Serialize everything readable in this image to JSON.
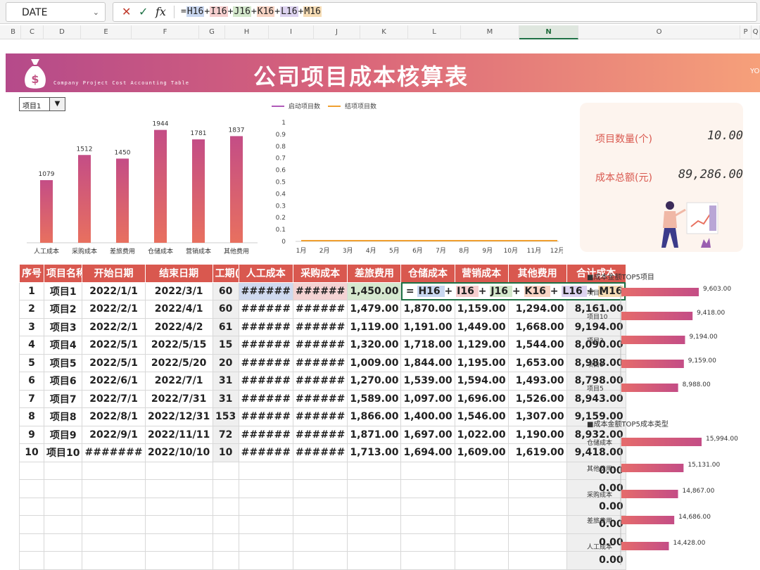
{
  "formula_bar": {
    "name_box": "DATE",
    "cancel_icon": "✕",
    "enter_icon": "✓",
    "fx_label": "fx",
    "formula_parts": [
      "=",
      "H16",
      "+",
      "I16",
      "+",
      "J16",
      "+",
      "K16",
      "+",
      "L16",
      "+",
      "M16"
    ]
  },
  "columns": [
    "B",
    "C",
    "D",
    "E",
    "F",
    "G",
    "H",
    "I",
    "J",
    "K",
    "L",
    "M",
    "N",
    "O",
    "P",
    "Q"
  ],
  "banner": {
    "title": "公司项目成本核算表",
    "subtitle": "Company Project Cost Accounting Table",
    "edge_text": "YO"
  },
  "dropdown": {
    "value": "项目1",
    "arrow": "▼"
  },
  "bar_chart": {
    "type": "bar",
    "categories": [
      "人工成本",
      "采购成本",
      "差旅费用",
      "仓储成本",
      "营销成本",
      "其他费用"
    ],
    "values": [
      1079,
      1512,
      1450,
      1944,
      1781,
      1837
    ],
    "ylim": [
      0,
      2000
    ],
    "colors": {
      "top": "#c44d86",
      "bottom": "#e8705f"
    }
  },
  "line_chart": {
    "type": "line",
    "legend": [
      "启动项目数",
      "结项项目数"
    ],
    "legend_colors": [
      "#b05ab8",
      "#f0a030"
    ],
    "x": [
      "1月",
      "2月",
      "3月",
      "4月",
      "5月",
      "6月",
      "7月",
      "8月",
      "9月",
      "10月",
      "11月",
      "12月"
    ],
    "yticks": [
      "1",
      "0.9",
      "0.8",
      "0.7",
      "0.6",
      "0.5",
      "0.4",
      "0.3",
      "0.2",
      "0.1",
      "0"
    ],
    "series": [
      {
        "name": "启动项目数",
        "values": [
          0,
          0,
          0,
          0,
          0,
          0,
          0,
          0,
          0,
          0,
          0,
          0
        ]
      },
      {
        "name": "结项项目数",
        "values": [
          0,
          0,
          0,
          0,
          0,
          0,
          0,
          0,
          0,
          0,
          0,
          0
        ]
      }
    ],
    "ylim": [
      0,
      1
    ]
  },
  "kpis": [
    {
      "label": "项目数量(个)",
      "value": "10.00"
    },
    {
      "label": "成本总额(元)",
      "value": "89,286.00"
    }
  ],
  "table": {
    "headers": [
      "序号",
      "项目名称",
      "开始日期",
      "结束日期",
      "工期(天)",
      "人工成本",
      "采购成本",
      "差旅费用",
      "仓储成本",
      "营销成本",
      "其他费用",
      "合计成本"
    ],
    "rows": [
      [
        "1",
        "项目1",
        "2022/1/1",
        "2022/3/1",
        "60",
        "######",
        "######",
        "1,450.00",
        "",
        "",
        "",
        ""
      ],
      [
        "2",
        "项目2",
        "2022/2/1",
        "2022/4/1",
        "60",
        "######",
        "######",
        "1,479.00",
        "1,870.00",
        "1,159.00",
        "1,294.00",
        "8,161.00"
      ],
      [
        "3",
        "项目3",
        "2022/2/1",
        "2022/4/2",
        "61",
        "######",
        "######",
        "1,119.00",
        "1,191.00",
        "1,449.00",
        "1,668.00",
        "9,194.00"
      ],
      [
        "4",
        "项目4",
        "2022/5/1",
        "2022/5/15",
        "15",
        "######",
        "######",
        "1,320.00",
        "1,718.00",
        "1,129.00",
        "1,544.00",
        "8,090.00"
      ],
      [
        "5",
        "项目5",
        "2022/5/1",
        "2022/5/20",
        "20",
        "######",
        "######",
        "1,009.00",
        "1,844.00",
        "1,195.00",
        "1,653.00",
        "8,988.00"
      ],
      [
        "6",
        "项目6",
        "2022/6/1",
        "2022/7/1",
        "31",
        "######",
        "######",
        "1,270.00",
        "1,539.00",
        "1,594.00",
        "1,493.00",
        "8,798.00"
      ],
      [
        "7",
        "项目7",
        "2022/7/1",
        "2022/7/31",
        "31",
        "######",
        "######",
        "1,589.00",
        "1,097.00",
        "1,696.00",
        "1,526.00",
        "8,943.00"
      ],
      [
        "8",
        "项目8",
        "2022/8/1",
        "2022/12/31",
        "153",
        "######",
        "######",
        "1,866.00",
        "1,400.00",
        "1,546.00",
        "1,307.00",
        "9,159.00"
      ],
      [
        "9",
        "项目9",
        "2022/9/1",
        "2022/11/11",
        "72",
        "######",
        "######",
        "1,871.00",
        "1,697.00",
        "1,022.00",
        "1,190.00",
        "8,932.00"
      ],
      [
        "10",
        "项目10",
        "#######",
        "2022/10/10",
        "10",
        "######",
        "######",
        "1,713.00",
        "1,694.00",
        "1,609.00",
        "1,619.00",
        "9,418.00"
      ]
    ],
    "empty_totals": [
      "0.00",
      "0.00",
      "0.00",
      "0.00",
      "0.00",
      "0.00"
    ],
    "inline_formula": "= H16 + I16 + J16 + K16 + L16 + M16"
  },
  "top5_projects": {
    "title": "■成本金额TOP5项目",
    "items": [
      {
        "name": "项目1",
        "value": 9603,
        "label": "9,603.00"
      },
      {
        "name": "项目10",
        "value": 9418,
        "label": "9,418.00"
      },
      {
        "name": "项目3",
        "value": 9194,
        "label": "9,194.00"
      },
      {
        "name": "项目8",
        "value": 9159,
        "label": "9,159.00"
      },
      {
        "name": "项目5",
        "value": 8988,
        "label": "8,988.00"
      }
    ]
  },
  "top5_types": {
    "title": "■成本金额TOP5成本类型",
    "items": [
      {
        "name": "仓储成本",
        "value": 15994,
        "label": "15,994.00"
      },
      {
        "name": "其他费用",
        "value": 15131,
        "label": "15,131.00"
      },
      {
        "name": "采购成本",
        "value": 14867,
        "label": "14,867.00"
      },
      {
        "name": "差旅费用",
        "value": 14686,
        "label": "14,686.00"
      },
      {
        "name": "人工成本",
        "value": 14428,
        "label": "14,428.00"
      }
    ]
  }
}
